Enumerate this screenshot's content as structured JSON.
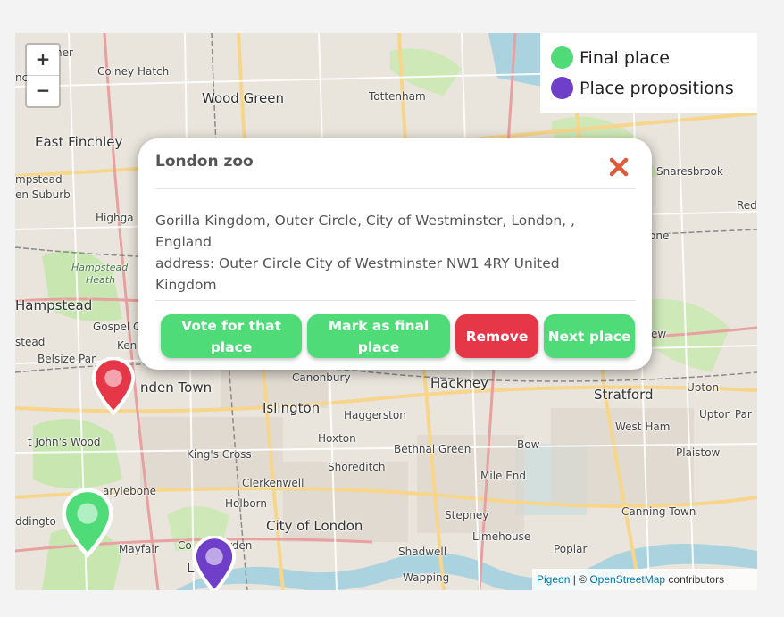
{
  "map": {
    "labels": [
      {
        "text": "Colney Hatch",
        "cls": "small"
      },
      {
        "text": "Wood Green",
        "cls": "big"
      },
      {
        "text": "Tottenham",
        "cls": "small"
      },
      {
        "text": "East Finchley",
        "cls": "big"
      },
      {
        "text": "mpstead",
        "cls": "small"
      },
      {
        "text": "en Suburb",
        "cls": "small"
      },
      {
        "text": "Highga",
        "cls": "small"
      },
      {
        "text": "Hampstead",
        "cls": "italic"
      },
      {
        "text": "Heath",
        "cls": "italic"
      },
      {
        "text": "Hampstead",
        "cls": "big"
      },
      {
        "text": "Gospel O",
        "cls": "small"
      },
      {
        "text": "Ken",
        "cls": "small"
      },
      {
        "text": "stead",
        "cls": "small"
      },
      {
        "text": "Belsize Par",
        "cls": "small"
      },
      {
        "text": "nden Town",
        "cls": "big"
      },
      {
        "text": "Canonbury",
        "cls": "small"
      },
      {
        "text": "Hackney",
        "cls": "big"
      },
      {
        "text": "Stratford",
        "cls": "big"
      },
      {
        "text": "Upton",
        "cls": "small"
      },
      {
        "text": "Islington",
        "cls": "big"
      },
      {
        "text": "Haggerston",
        "cls": "small"
      },
      {
        "text": "Upton Par",
        "cls": "small"
      },
      {
        "text": "West Ham",
        "cls": "small"
      },
      {
        "text": "t John's Wood",
        "cls": "small"
      },
      {
        "text": "Hoxton",
        "cls": "small"
      },
      {
        "text": "Bow",
        "cls": "small"
      },
      {
        "text": "Bethnal Green",
        "cls": "small"
      },
      {
        "text": "King's Cross",
        "cls": "small"
      },
      {
        "text": "Plaistow",
        "cls": "small"
      },
      {
        "text": "Shoreditch",
        "cls": "small"
      },
      {
        "text": "Mile End",
        "cls": "small"
      },
      {
        "text": "Clerkenwell",
        "cls": "small"
      },
      {
        "text": "arylebone",
        "cls": "small"
      },
      {
        "text": "Holborn",
        "cls": "small"
      },
      {
        "text": "ddingto",
        "cls": "small"
      },
      {
        "text": "Stepney",
        "cls": "small"
      },
      {
        "text": "Canning Town",
        "cls": "small"
      },
      {
        "text": "City of London",
        "cls": "big"
      },
      {
        "text": "Limehouse",
        "cls": "small"
      },
      {
        "text": "Mayfair",
        "cls": "small"
      },
      {
        "text": "Co",
        "cords": "",
        "cls": "small"
      },
      {
        "text": "rden",
        "cls": "small"
      },
      {
        "text": "Shadwell",
        "cls": "small"
      },
      {
        "text": "Poplar",
        "cls": "small"
      },
      {
        "text": "Wapping",
        "cls": "small"
      },
      {
        "text": "Snaresbrook",
        "cls": "small"
      },
      {
        "text": "Red",
        "cls": "small"
      },
      {
        "text": "one",
        "cls": "small"
      },
      {
        "text": "ew",
        "cls": "small"
      },
      {
        "text": "ner",
        "cls": "small"
      },
      {
        "text": "nc",
        "cls": "small"
      },
      {
        "text": "L",
        "cls": "big"
      }
    ],
    "markers": [
      {
        "name": "marker-red",
        "color": "#e53748"
      },
      {
        "name": "marker-green",
        "color": "#4fdc78"
      },
      {
        "name": "marker-purple",
        "color": "#6f3fc9"
      }
    ]
  },
  "zoom": {
    "in_label": "+",
    "out_label": "−"
  },
  "legend": {
    "items": [
      {
        "label": "Final place",
        "color": "#4fdc78"
      },
      {
        "label": "Place propositions",
        "color": "#6f3fc9"
      }
    ]
  },
  "popup": {
    "title": "London zoo",
    "close_icon": "close-x-icon",
    "close_color": "#e05a3a",
    "body_line1": "Gorilla Kingdom, Outer Circle, City of Westminster, London, , England",
    "body_line2": "address: Outer Circle City of Westminster NW1 4RY United Kingdom",
    "buttons": {
      "vote": "Vote for that place",
      "mark_final": "Mark as final place",
      "remove": "Remove",
      "next": "Next place"
    }
  },
  "attribution": {
    "pigeon": "Pigeon",
    "separator": " | © ",
    "osm": "OpenStreetMap",
    "suffix": " contributors"
  }
}
